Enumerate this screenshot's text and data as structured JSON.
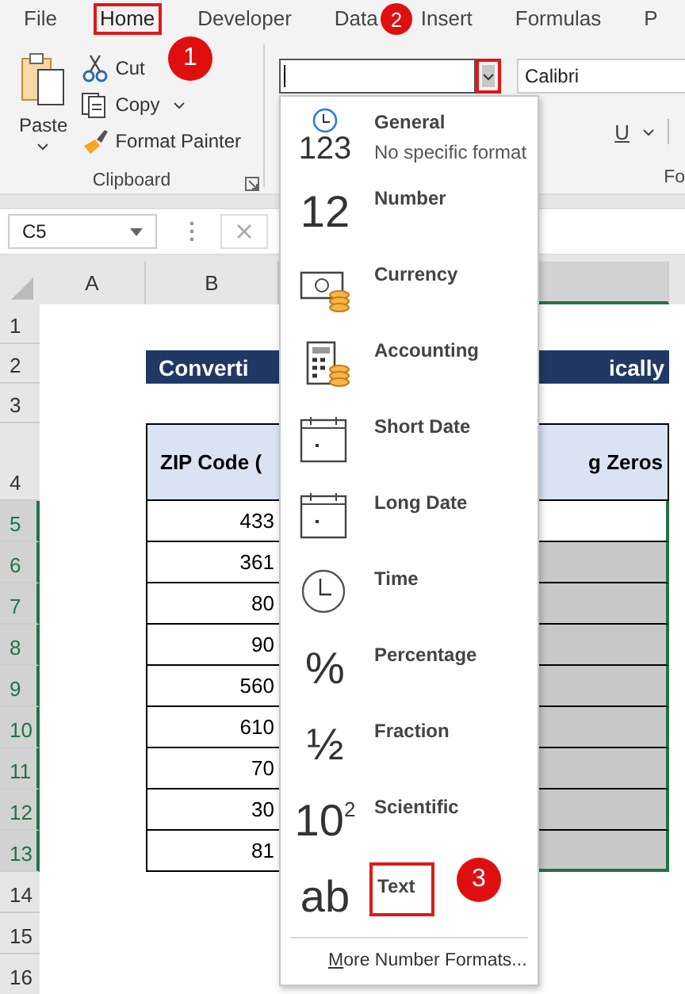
{
  "menu_tabs": [
    {
      "label": "File",
      "selected": false,
      "highlighted": false
    },
    {
      "label": "Home",
      "selected": true,
      "highlighted": true
    },
    {
      "label": "Developer",
      "selected": false,
      "highlighted": false
    },
    {
      "label": "Data",
      "selected": false,
      "highlighted": false
    },
    {
      "label": "Insert",
      "selected": false,
      "highlighted": false
    },
    {
      "label": "Formulas",
      "selected": false,
      "highlighted": false
    },
    {
      "label": "P",
      "selected": false,
      "highlighted": false
    }
  ],
  "clipboard": {
    "paste": "Paste",
    "cut": "Cut",
    "copy": "Copy",
    "format_painter": "Format Painter",
    "group_label": "Clipboard"
  },
  "number_format": {
    "dropdown_highlighted": true
  },
  "font": {
    "name": "Calibri",
    "underline": "U",
    "group_label": "Fo"
  },
  "name_box": {
    "value": "C5"
  },
  "columns": [
    {
      "label": "A",
      "selected": false
    },
    {
      "label": "B",
      "selected": false
    },
    {
      "selected": true
    }
  ],
  "rows": [
    {
      "header": "1",
      "selected": false,
      "kind": "blank"
    },
    {
      "header": "2",
      "selected": false,
      "kind": "title",
      "b": "Converti",
      "c": "ically"
    },
    {
      "header": "3",
      "selected": false,
      "kind": "blank"
    },
    {
      "header": "4",
      "selected": false,
      "kind": "table_header",
      "b": "ZIP Code (",
      "c": "g Zeros"
    },
    {
      "header": "5",
      "selected": true,
      "kind": "data",
      "b": "433",
      "active": true
    },
    {
      "header": "6",
      "selected": true,
      "kind": "data",
      "b": "361",
      "active": false
    },
    {
      "header": "7",
      "selected": true,
      "kind": "data",
      "b": "80",
      "active": false
    },
    {
      "header": "8",
      "selected": true,
      "kind": "data",
      "b": "90",
      "active": false
    },
    {
      "header": "9",
      "selected": true,
      "kind": "data",
      "b": "560",
      "active": false
    },
    {
      "header": "10",
      "selected": true,
      "kind": "data",
      "b": "610",
      "active": false
    },
    {
      "header": "11",
      "selected": true,
      "kind": "data",
      "b": "70",
      "active": false
    },
    {
      "header": "12",
      "selected": true,
      "kind": "data",
      "b": "30",
      "active": false
    },
    {
      "header": "13",
      "selected": true,
      "kind": "data",
      "b": "81",
      "active": false
    },
    {
      "header": "14",
      "selected": false,
      "kind": "blank"
    },
    {
      "header": "15",
      "selected": false,
      "kind": "blank"
    },
    {
      "header": "16",
      "selected": false,
      "kind": "blank"
    }
  ],
  "format_menu": {
    "items": [
      {
        "kind": "general",
        "glyph": "123",
        "label": "General",
        "description": "No specific format",
        "highlighted": false
      },
      {
        "kind": "number",
        "glyph": "12",
        "label": "Number",
        "highlighted": false
      },
      {
        "kind": "currency",
        "label": "Currency",
        "highlighted": false
      },
      {
        "kind": "accounting",
        "label": "Accounting",
        "highlighted": false
      },
      {
        "kind": "short_date",
        "label": "Short Date",
        "highlighted": false
      },
      {
        "kind": "long_date",
        "label": "Long Date",
        "highlighted": false
      },
      {
        "kind": "time",
        "label": "Time",
        "highlighted": false
      },
      {
        "kind": "percentage",
        "glyph": "%",
        "label": "Percentage",
        "highlighted": false
      },
      {
        "kind": "fraction",
        "glyph": "½",
        "label": "Fraction",
        "highlighted": false
      },
      {
        "kind": "scientific",
        "glyph": "10$^{2}$",
        "label": "Scientific",
        "highlighted": false
      },
      {
        "kind": "text",
        "glyph": "ab",
        "label": "Text",
        "highlighted": true
      }
    ],
    "footer": "More Number Formats..."
  },
  "callouts": [
    {
      "number": "1"
    },
    {
      "number": "2"
    },
    {
      "number": "3"
    }
  ]
}
